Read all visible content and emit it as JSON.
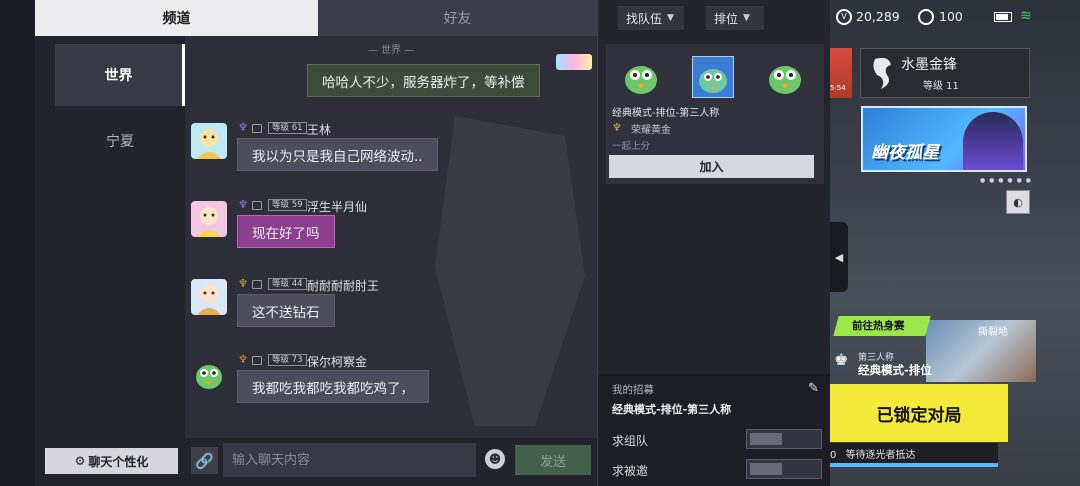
{
  "tabs": {
    "channel": "频道",
    "friends": "好友"
  },
  "channels": [
    {
      "label": "世界"
    },
    {
      "label": "宁夏"
    }
  ],
  "custom_button": {
    "icon": "gear-icon",
    "glyph": "⚙",
    "label": "聊天个性化"
  },
  "chat": {
    "divider": "— 世界 —",
    "self_message": "哈哈人不少，服务器炸了，等补偿",
    "messages": [
      {
        "rank_icon": "purple-rank-icon",
        "rank_color": "#a879e8",
        "level": "等级 61",
        "name": "王林",
        "text": "我以为只是我自己网络波动.."
      },
      {
        "rank_icon": "purple-rank-icon",
        "rank_color": "#a879e8",
        "level": "等级 59",
        "name": "浮生半月仙",
        "text": "现在好了吗"
      },
      {
        "rank_icon": "gold-rank-icon",
        "rank_color": "#d8b24a",
        "level": "等级 44",
        "name": "耐耐耐耐肘王",
        "text": "这不送钻石"
      },
      {
        "rank_icon": "orange-rank-icon",
        "rank_color": "#e0973c",
        "level": "等级 73",
        "name": "保尔柯察金",
        "text": "我都吃我都吃我都吃鸡了，"
      }
    ]
  },
  "input": {
    "placeholder": "输入聊天内容",
    "send_label": "发送"
  },
  "team": {
    "find_team": "找队伍",
    "rank": "排位",
    "card": {
      "mode": "经典模式-排位-第三人称",
      "rank_name": "荣耀黄金",
      "note": "一起上分",
      "join_label": "加入"
    }
  },
  "recruit": {
    "title": "我的招募",
    "mode": "经典模式-排位-第三人称",
    "rows": [
      {
        "label": "求组队"
      },
      {
        "label": "求被邀"
      }
    ]
  },
  "status": {
    "coins": "20,289",
    "diamonds": "100"
  },
  "event": {
    "title": "水墨金锋",
    "level": "等级 11",
    "left_thumb_text": "5:54"
  },
  "promo": {
    "title": "幽夜孤星"
  },
  "lobby": {
    "warmup": "前往热身赛",
    "map": "撕裂地",
    "mode_small": "第三人称",
    "mode_big": "经典模式-排位",
    "match_button": "已锁定对局",
    "status_prefix": "0",
    "status_text": "等待逐光者抵达"
  }
}
